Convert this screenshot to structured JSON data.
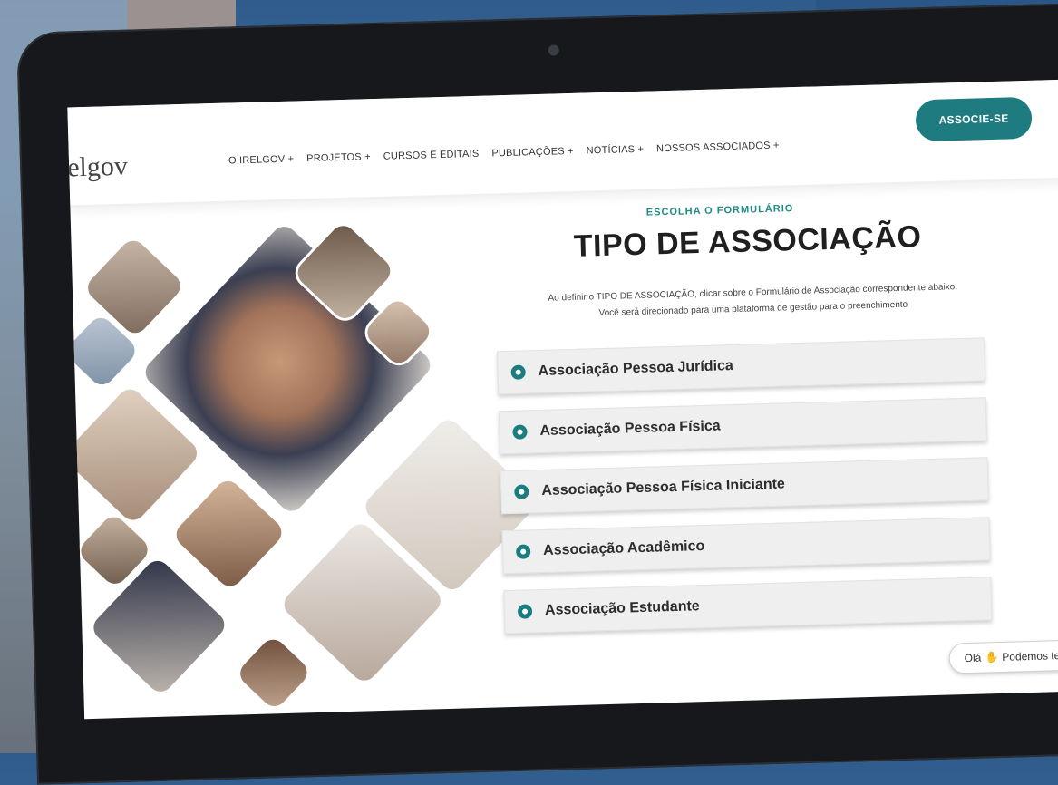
{
  "header": {
    "logo": "elgov",
    "nav": [
      "O IRELGOV +",
      "PROJETOS +",
      "CURSOS E EDITAIS",
      "PUBLICAÇÕES +",
      "NOTÍCIAS +",
      "NOSSOS ASSOCIADOS +"
    ],
    "cta": "ASSOCIE-SE"
  },
  "main": {
    "eyebrow": "ESCOLHA O FORMULÁRIO",
    "title": "TIPO DE ASSOCIAÇÃO",
    "description_line1": "Ao definir o TIPO DE ASSOCIAÇÃO, clicar sobre o Formulário de Associação correspondente abaixo.",
    "description_line2": "Você será direcionado para uma plataforma de gestão para o preenchimento",
    "options": [
      "Associação Pessoa Jurídica",
      "Associação Pessoa Física",
      "Associação Pessoa Física Iniciante",
      "Associação Acadêmico",
      "Associação Estudante"
    ]
  },
  "chat": {
    "greeting": "Olá",
    "text": "Podemos te"
  },
  "colors": {
    "accent": "#1e7b7f",
    "eyebrow": "#1e8b86"
  }
}
